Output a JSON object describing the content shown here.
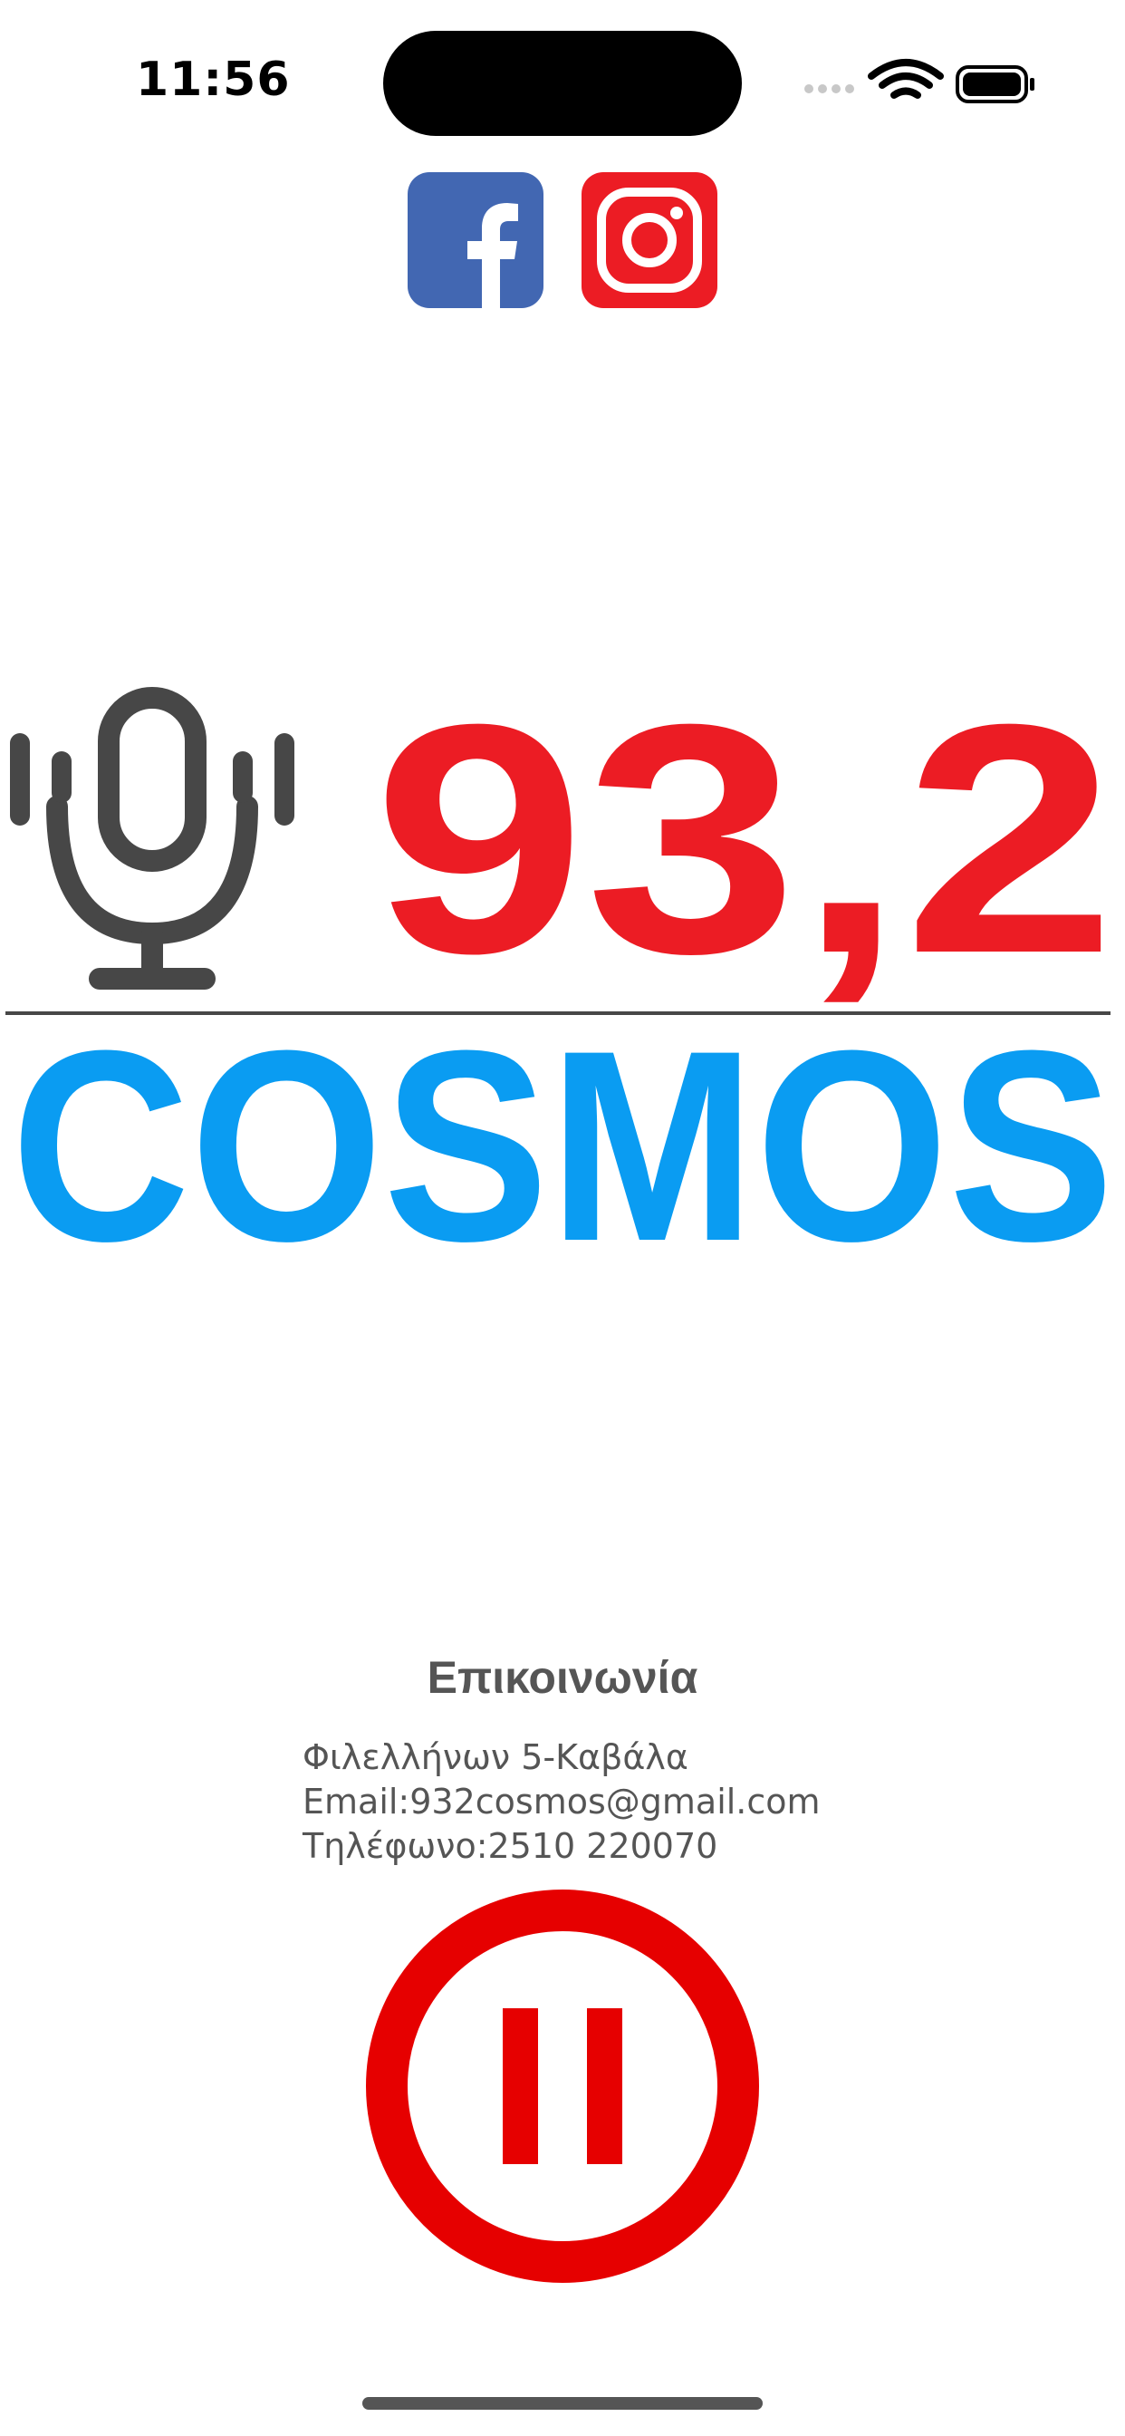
{
  "status_bar": {
    "time": "11:56"
  },
  "social": {
    "facebook_icon": "facebook-icon",
    "instagram_icon": "instagram-icon",
    "facebook_color": "#4267b2",
    "instagram_color": "#ec1c24"
  },
  "logo": {
    "frequency": "93,2",
    "station_name": "COSMOS",
    "mic_icon": "microphone-icon",
    "frequency_color": "#ec1c24",
    "name_color": "#0a9cf2",
    "mic_color": "#474747"
  },
  "contact": {
    "title": "Επικοινωνία",
    "address": "Φιλελλήνων 5-Καβάλα",
    "email": "Email:932cosmos@gmail.com",
    "phone": "Τηλέφωνο:2510 220070"
  },
  "player": {
    "pause_icon": "pause-icon",
    "color": "#e60000"
  }
}
